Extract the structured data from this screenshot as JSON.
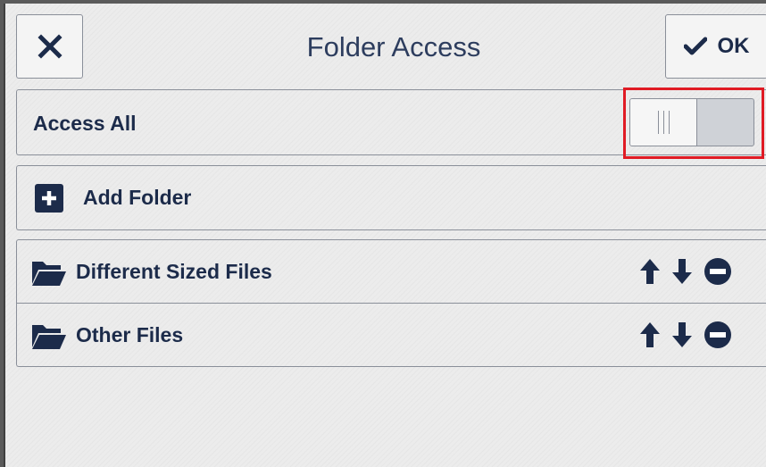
{
  "header": {
    "title": "Folder Access",
    "ok_label": "OK",
    "close_icon": "close-icon",
    "ok_icon": "check-icon"
  },
  "access_all": {
    "label": "Access All",
    "toggle_state": "off"
  },
  "add_folder": {
    "label": "Add Folder",
    "icon": "plus-square-icon"
  },
  "folders": [
    {
      "name": "Different Sized Files",
      "icon": "folder-open-icon"
    },
    {
      "name": "Other Files",
      "icon": "folder-open-icon"
    }
  ],
  "colors": {
    "primary": "#1c2b4a",
    "title": "#2d3d5e",
    "background": "#ececec",
    "border": "#8a8f99",
    "highlight": "#e01b24"
  }
}
